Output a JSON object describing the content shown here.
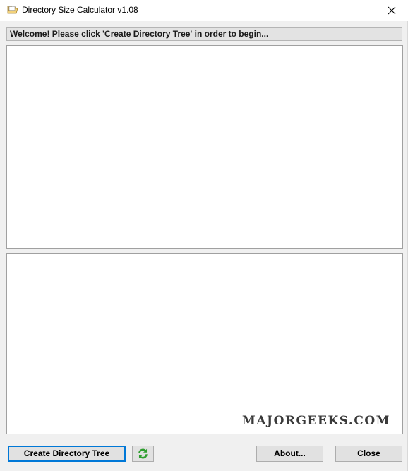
{
  "window": {
    "title": "Directory Size Calculator v1.08",
    "icon": "folder-icon"
  },
  "status": {
    "message": "Welcome! Please click 'Create Directory Tree' in order to begin..."
  },
  "watermark": {
    "text": "MAJORGEEKS.COM"
  },
  "buttons": {
    "create_label": "Create Directory Tree",
    "refresh_icon": "refresh-icon",
    "about_label": "About...",
    "close_label": "Close"
  },
  "colors": {
    "focus_border": "#0078d7",
    "refresh_green": "#2e9e2e"
  }
}
